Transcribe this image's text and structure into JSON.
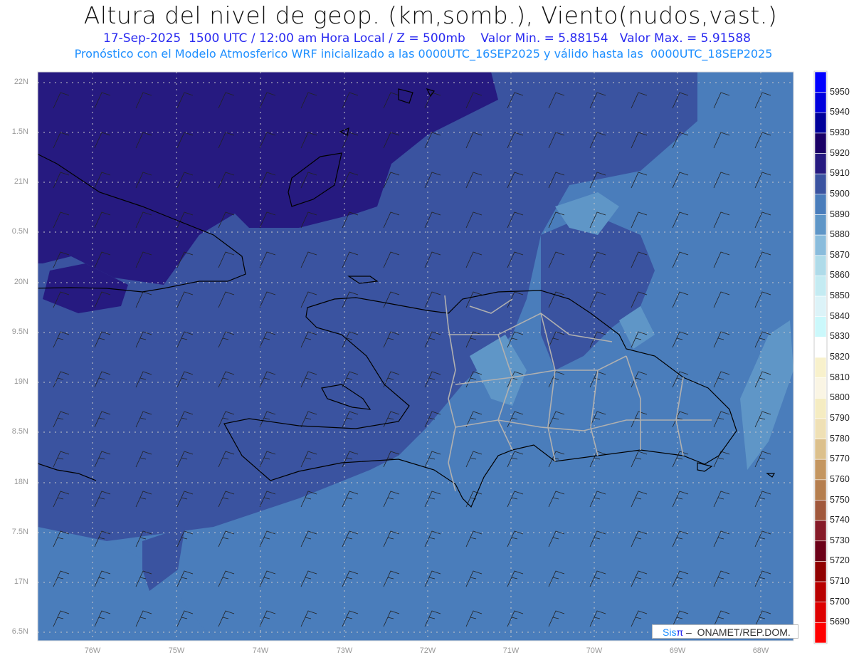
{
  "header": {
    "title": "Altura del nivel de geop. (km,somb.), Viento(nudos,vast.)",
    "subtitle": "17-Sep-2025  1500 UTC / 12:00 am Hora Local / Z = 500mb    Valor Min. = 5.88154   Valor Max. = 5.91588",
    "forecast_line": "Pronóstico con el Modelo Atmosferico WRF inicializado a las 0000UTC_16SEP2025 y válido hasta las  0000UTC_18SEP2025"
  },
  "axes": {
    "lat_labels": [
      "22N",
      "1.5N",
      "21N",
      "0.5N",
      "20N",
      "9.5N",
      "19N",
      "8.5N",
      "18N",
      "7.5N",
      "17N",
      "6.5N"
    ],
    "lon_labels": [
      "76W",
      "75W",
      "74W",
      "73W",
      "72W",
      "71W",
      "70W",
      "69W",
      "68W"
    ]
  },
  "colorbar": {
    "labels": [
      "5950",
      "5940",
      "5930",
      "5920",
      "5910",
      "5900",
      "5890",
      "5880",
      "5870",
      "5860",
      "5850",
      "5840",
      "5830",
      "5820",
      "5810",
      "5800",
      "5790",
      "5780",
      "5770",
      "5760",
      "5750",
      "5740",
      "5730",
      "5720",
      "5710",
      "5700",
      "5690"
    ],
    "colors": [
      "#0000ff",
      "#0000dd",
      "#00009a",
      "#1a0066",
      "#261a80",
      "#3a53a0",
      "#4a7dbb",
      "#5f96c7",
      "#8abcdc",
      "#afdbe9",
      "#c4ebf2",
      "#dcf3f8",
      "#cbf8fb",
      "#ffffff",
      "#f8f1cc",
      "#faf5e4",
      "#f5ecc2",
      "#efe0b5",
      "#dcc08c",
      "#c49660",
      "#b57e4e",
      "#a0583c",
      "#861a28",
      "#6c0018",
      "#900000",
      "#b80000",
      "#dd0000",
      "#ff0000"
    ]
  },
  "logo": {
    "sis": "Sis",
    "pi": "π",
    "rest": " –  ONAMET/REP.DOM."
  }
}
